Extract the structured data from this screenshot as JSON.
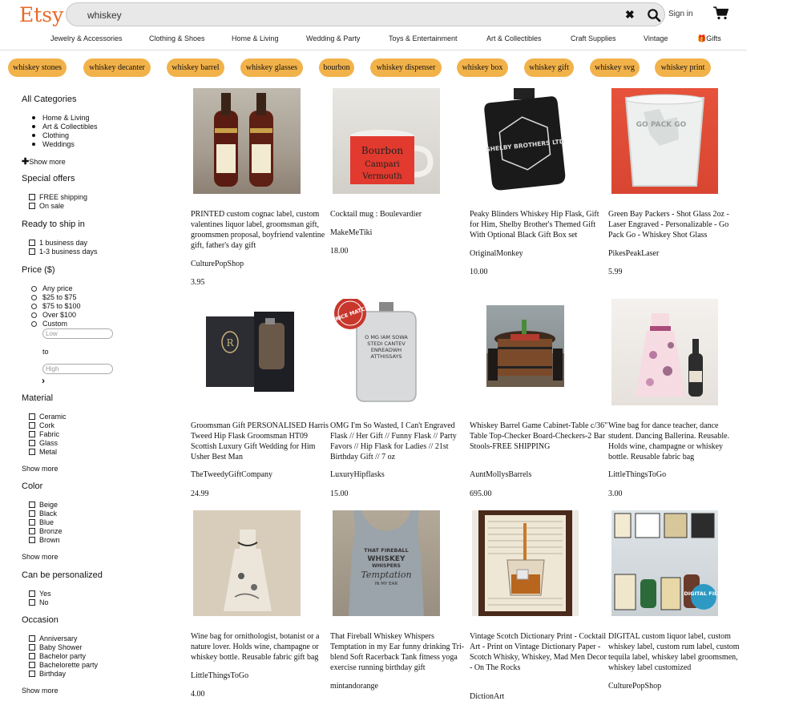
{
  "header": {
    "logo": "Etsy",
    "search_value": "whiskey",
    "sign_in": "Sign in"
  },
  "nav": [
    "Jewelry & Accessories",
    "Clothing & Shoes",
    "Home & Living",
    "Wedding & Party",
    "Toys & Entertainment",
    "Art & Collectibles",
    "Craft Supplies",
    "Vintage",
    "Gifts"
  ],
  "related_searches": [
    "whiskey stones",
    "whiskey decanter",
    "whiskey barrel",
    "whiskey glasses",
    "bourbon",
    "whiskey dispenser",
    "whiskey box",
    "whiskey gift",
    "whiskey svg",
    "whiskey print"
  ],
  "sidebar": {
    "categories_title": "All Categories",
    "categories": [
      "Home & Living",
      "Art & Collectibles",
      "Clothing",
      "Weddings"
    ],
    "categories_show_more": "Show more",
    "special_offers_title": "Special offers",
    "special_offers": [
      "FREE shipping",
      "On sale"
    ],
    "ready_title": "Ready to ship in",
    "ready_options": [
      "1 business day",
      "1-3 business days"
    ],
    "price_title": "Price ($)",
    "price_options": [
      "Any price",
      "$25 to $75",
      "$75 to $100",
      "Over $100",
      "Custom"
    ],
    "price_low_placeholder": "Low",
    "price_to": "to",
    "price_high_placeholder": "High",
    "material_title": "Material",
    "materials": [
      "Ceramic",
      "Cork",
      "Fabric",
      "Glass",
      "Metal"
    ],
    "material_show_more": "Show more",
    "color_title": "Color",
    "colors": [
      "Beige",
      "Black",
      "Blue",
      "Bronze",
      "Brown"
    ],
    "color_show_more": "Show more",
    "personalized_title": "Can be personalized",
    "personalized": [
      "Yes",
      "No"
    ],
    "occasion_title": "Occasion",
    "occasions": [
      "Anniversary",
      "Baby Shower",
      "Bachelor party",
      "Bachelorette party",
      "Birthday"
    ],
    "occasion_show_more": "Show more"
  },
  "products": [
    {
      "title": "PRINTED custom cognac label, custom valentines liquor label, groomsman gift, groomsmen proposal, boyfriend valentine gift, father's day gift",
      "shop": "CulturePopShop",
      "price": "3.95"
    },
    {
      "title": "Cocktail mug : Boulevardier",
      "shop": "MakeMeTiki",
      "price": "18.00",
      "mug_words": [
        "Bourbon",
        "Campari",
        "Vermouth"
      ]
    },
    {
      "title": "Peaky Blinders Whiskey Hip Flask, Gift for Him, Shelby Brother's Themed Gift With Optional Black Gift Box set",
      "shop": "OriginalMonkey",
      "price": "10.00",
      "flask_text": "SHELBY BROTHERS LTD"
    },
    {
      "title": "Green Bay Packers - Shot Glass 2oz - Laser Engraved - Personalizable - Go Pack Go - Whiskey Shot Glass",
      "shop": "PikesPeakLaser",
      "price": "5.99",
      "glass_text": "GO PACK GO"
    },
    {
      "title": "Groomsman Gift PERSONALISED Harris Tweed Hip Flask Groomsman HT09 Scottish Luxury Gift Wedding for Him Usher Best Man",
      "shop": "TheTweedyGiftCompany",
      "price": "24.99"
    },
    {
      "title": "OMG I'm So Wasted, I Can't Engraved Flask // Her Gift // Funny Flask // Party Favors // Hip Flask for Ladies // 21st Birthday Gift // 7 oz",
      "shop": "LuxuryHipflasks",
      "price": "15.00",
      "badge": "PRICE MATCH",
      "flask_text": "O MG IAM SOWA STEDI CANTEV ENREADWH ATTHISSAYS"
    },
    {
      "title": "Whiskey Barrel Game Cabinet-Table c/36\" Table Top-Checker Board-Checkers-2 Bar Stools-FREE SHIPPING",
      "shop": "AuntMollysBarrels",
      "price": "695.00"
    },
    {
      "title": "Wine bag for dance teacher, dance student. Dancing Ballerina. Reusable. Holds wine, champagne or whiskey bottle. Reusable fabric bag",
      "shop": "LittleThingsToGo",
      "price": "3.00"
    },
    {
      "title": "Wine bag for ornithologist, botanist or a nature lover. Holds wine, champagne or whiskey bottle. Reusable fabric gift bag",
      "shop": "LittleThingsToGo",
      "price": "4.00"
    },
    {
      "title": "That Fireball Whiskey Whispers Temptation in my Ear funny drinking Tri-blend Soft Racerback Tank fitness yoga exercise running birthday gift",
      "shop": "mintandorange",
      "price": "",
      "shirt_text": [
        "THAT FIREBALL",
        "WHISKEY",
        "WHISPERS",
        "Temptation",
        "IN MY EAR"
      ]
    },
    {
      "title": "Vintage Scotch Dictionary Print - Cocktail Art - Print on Vintage Dictionary Paper - Scotch Whisky, Whiskey, Mad Men Decor - On The Rocks",
      "shop": "DictionArt",
      "price": ""
    },
    {
      "title": "DIGITAL custom liquor label, custom whiskey label, custom rum label, custom tequila label, whiskey label groomsmen, whiskey label customized",
      "shop": "CulturePopShop",
      "price": "",
      "badge": "DIGITAL FILE!"
    }
  ],
  "colors": {
    "brand": "#e86a2a",
    "pill": "#f2b24a"
  }
}
